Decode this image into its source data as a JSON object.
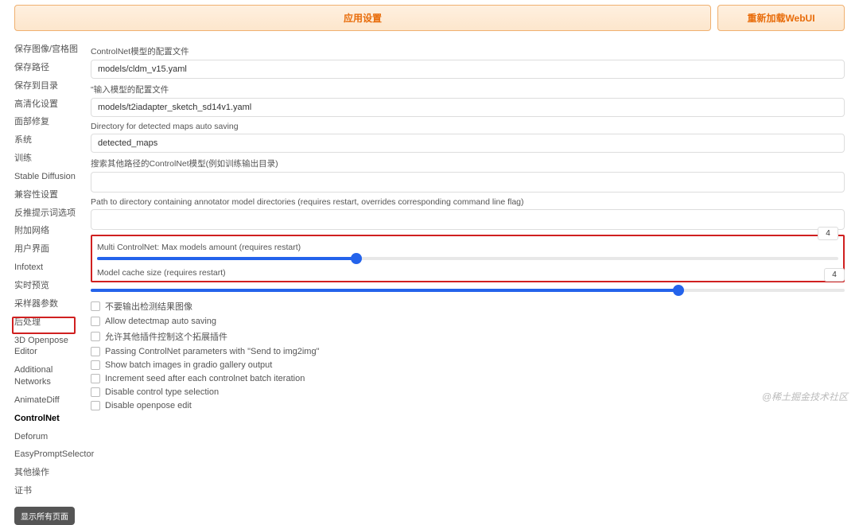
{
  "topbar": {
    "apply": "应用设置",
    "reload": "重新加载WebUI"
  },
  "sidebar": {
    "items": [
      "保存图像/宫格图",
      "保存路径",
      "保存到目录",
      "高清化设置",
      "面部修复",
      "系统",
      "训练",
      "Stable Diffusion",
      "兼容性设置",
      "反推提示词选项",
      "附加网络",
      "用户界面",
      "Infotext",
      "实时预览",
      "采样器参数",
      "后处理",
      "3D Openpose Editor",
      "Additional Networks",
      "AnimateDiff",
      "ControlNet",
      "Deforum",
      "EasyPromptSelector",
      "其他操作",
      "证书"
    ],
    "selected_index": 19,
    "show_all": "显示所有页面"
  },
  "main": {
    "field1_label": "ControlNet模型的配置文件",
    "field1_value": "models/cldm_v15.yaml",
    "field2_label": "\"输入模型的配置文件",
    "field2_value": "models/t2iadapter_sketch_sd14v1.yaml",
    "field3_label": "Directory for detected maps auto saving",
    "field3_value": "detected_maps",
    "field4_label": "搜索其他路径的ControlNet模型(例如训练输出目录)",
    "field5_label": "Path to directory containing annotator model directories (requires restart, overrides corresponding command line flag)",
    "slider1_label": "Multi ControlNet: Max models amount (requires restart)",
    "slider1_value": "4",
    "slider1_fill_pct": 35,
    "slider2_label": "Model cache size (requires restart)",
    "slider2_value": "4",
    "slider2_fill_pct": 78,
    "checks": [
      "不要输出检测结果图像",
      "Allow detectmap auto saving",
      "允许其他插件控制这个拓展插件",
      "Passing ControlNet parameters with \"Send to img2img\"",
      "Show batch images in gradio gallery output",
      "Increment seed after each controlnet batch iteration",
      "Disable control type selection",
      "Disable openpose edit"
    ]
  },
  "watermark": "@稀土掘金技术社区"
}
